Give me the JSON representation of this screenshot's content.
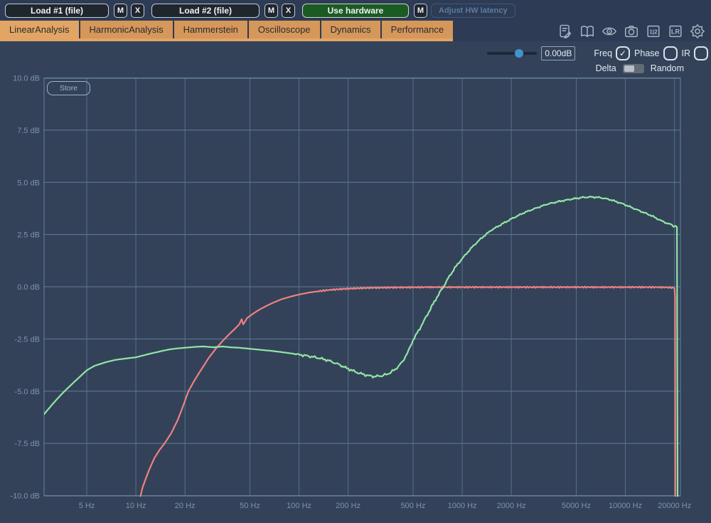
{
  "toolbar": {
    "load1_label": "Load #1 (file)",
    "m1_label": "M",
    "x1_label": "X",
    "load2_label": "Load #2 (file)",
    "m2_label": "M",
    "x2_label": "X",
    "use_hardware_label": "Use hardware",
    "m3_label": "M",
    "adjust_latency_label": "Adjust HW latency"
  },
  "tabs": [
    {
      "label": "LinearAnalysis",
      "active": true
    },
    {
      "label": "HarmonicAnalysis",
      "active": false
    },
    {
      "label": "Hammerstein",
      "active": false
    },
    {
      "label": "Oscilloscope",
      "active": false
    },
    {
      "label": "Dynamics",
      "active": false
    },
    {
      "label": "Performance",
      "active": false
    }
  ],
  "tab_icons": [
    {
      "name": "report-edit-icon"
    },
    {
      "name": "manual-book-icon"
    },
    {
      "name": "eye-icon"
    },
    {
      "name": "snapshot-camera-icon"
    },
    {
      "name": "channel-12-icon",
      "label": "1|2"
    },
    {
      "name": "channel-lr-icon",
      "label": "LR"
    },
    {
      "name": "settings-gear-icon"
    }
  ],
  "glyphs": {
    "check": "✓"
  },
  "controls": {
    "gain_value": "0.00dB",
    "slider_position": 0.67,
    "checkboxes": [
      {
        "id": "freq",
        "label": "Freq",
        "checked": true
      },
      {
        "id": "phase",
        "label": "Phase",
        "checked": false
      },
      {
        "id": "ir",
        "label": "IR",
        "checked": false
      }
    ],
    "delta_label": "Delta",
    "random_label": "Random",
    "delta_random_state": "left"
  },
  "store_button_label": "Store",
  "colors": {
    "topbar_bg": "#2d3b54",
    "chart_bg": "#334259",
    "tab_active": "#e2a565",
    "tab_inactive": "#d5975a",
    "use_hardware_green": "#1c5a24",
    "grid_h": "#7190ab",
    "grid_v": "#5b7c99",
    "axis_text": "#7c93aa",
    "series_red": "#ee8181",
    "series_green": "#92e5a5"
  },
  "chart_data": {
    "type": "line",
    "x_scale": "log",
    "x_unit": "Hz",
    "y_unit": "dB",
    "xlim": [
      2.74,
      21700
    ],
    "ylim": [
      -10,
      10
    ],
    "grid": true,
    "x_ticks": [
      {
        "f": 5,
        "label": "5 Hz"
      },
      {
        "f": 10,
        "label": "10 Hz"
      },
      {
        "f": 20,
        "label": "20 Hz"
      },
      {
        "f": 50,
        "label": "50 Hz"
      },
      {
        "f": 100,
        "label": "100 Hz"
      },
      {
        "f": 200,
        "label": "200 Hz"
      },
      {
        "f": 500,
        "label": "500 Hz"
      },
      {
        "f": 1000,
        "label": "1000 Hz"
      },
      {
        "f": 2000,
        "label": "2000 Hz"
      },
      {
        "f": 5000,
        "label": "5000 Hz"
      },
      {
        "f": 10000,
        "label": "10000 Hz"
      },
      {
        "f": 20000,
        "label": "20000 Hz"
      }
    ],
    "y_ticks": [
      {
        "v": 10,
        "label": "10.0 dB"
      },
      {
        "v": 7.5,
        "label": "7.5 dB"
      },
      {
        "v": 5,
        "label": "5.0 dB"
      },
      {
        "v": 2.5,
        "label": "2.5 dB"
      },
      {
        "v": 0,
        "label": "0.0 dB"
      },
      {
        "v": -2.5,
        "label": "-2.5 dB"
      },
      {
        "v": -5,
        "label": "-5.0 dB"
      },
      {
        "v": -7.5,
        "label": "-7.5 dB"
      },
      {
        "v": -10,
        "label": "-10.0 dB"
      }
    ],
    "series": [
      {
        "name": "red-curve-highpass",
        "color": "#ee8181",
        "points": [
          [
            10.4,
            -10.4
          ],
          [
            11,
            -9.6
          ],
          [
            12,
            -8.8
          ],
          [
            13,
            -8.2
          ],
          [
            14,
            -7.8
          ],
          [
            15,
            -7.5
          ],
          [
            16.5,
            -7.0
          ],
          [
            18,
            -6.4
          ],
          [
            19.5,
            -5.7
          ],
          [
            21,
            -5.0
          ],
          [
            23,
            -4.45
          ],
          [
            25,
            -4.0
          ],
          [
            28,
            -3.4
          ],
          [
            31,
            -2.95
          ],
          [
            34,
            -2.6
          ],
          [
            37,
            -2.3
          ],
          [
            40,
            -2.05
          ],
          [
            43,
            -1.8
          ],
          [
            44.5,
            -1.55
          ],
          [
            45.5,
            -1.8
          ],
          [
            48,
            -1.5
          ],
          [
            52,
            -1.3
          ],
          [
            57,
            -1.1
          ],
          [
            63,
            -0.92
          ],
          [
            70,
            -0.75
          ],
          [
            78,
            -0.6
          ],
          [
            88,
            -0.48
          ],
          [
            100,
            -0.37
          ],
          [
            115,
            -0.28
          ],
          [
            135,
            -0.2
          ],
          [
            160,
            -0.14
          ],
          [
            190,
            -0.1
          ],
          [
            230,
            -0.07
          ],
          [
            280,
            -0.05
          ],
          [
            350,
            -0.04
          ],
          [
            450,
            -0.03
          ],
          [
            600,
            -0.02
          ],
          [
            800,
            -0.02
          ],
          [
            1100,
            -0.02
          ],
          [
            1600,
            -0.02
          ],
          [
            2400,
            -0.02
          ],
          [
            3500,
            -0.02
          ],
          [
            5000,
            -0.02
          ],
          [
            7500,
            -0.02
          ],
          [
            11000,
            -0.02
          ],
          [
            15000,
            -0.02
          ],
          [
            18000,
            -0.03
          ],
          [
            19500,
            -0.04
          ],
          [
            20000,
            -0.08
          ],
          [
            20150,
            -0.5
          ],
          [
            20250,
            -10.6
          ]
        ]
      },
      {
        "name": "green-curve-response",
        "color": "#92e5a5",
        "points": [
          [
            2.74,
            -6.1
          ],
          [
            3.1,
            -5.6
          ],
          [
            3.6,
            -5.05
          ],
          [
            4.2,
            -4.55
          ],
          [
            5.0,
            -4.0
          ],
          [
            5.6,
            -3.78
          ],
          [
            6.5,
            -3.62
          ],
          [
            7.5,
            -3.5
          ],
          [
            9,
            -3.42
          ],
          [
            10,
            -3.38
          ],
          [
            12,
            -3.22
          ],
          [
            14,
            -3.1
          ],
          [
            16,
            -3.0
          ],
          [
            18,
            -2.95
          ],
          [
            20,
            -2.92
          ],
          [
            23,
            -2.88
          ],
          [
            26,
            -2.86
          ],
          [
            30,
            -2.9
          ],
          [
            34,
            -2.86
          ],
          [
            38,
            -2.9
          ],
          [
            43,
            -2.92
          ],
          [
            50,
            -2.97
          ],
          [
            58,
            -3.02
          ],
          [
            68,
            -3.07
          ],
          [
            80,
            -3.14
          ],
          [
            95,
            -3.22
          ],
          [
            110,
            -3.3
          ],
          [
            130,
            -3.4
          ],
          [
            150,
            -3.52
          ],
          [
            175,
            -3.72
          ],
          [
            200,
            -3.93
          ],
          [
            230,
            -4.12
          ],
          [
            260,
            -4.24
          ],
          [
            290,
            -4.3
          ],
          [
            320,
            -4.26
          ],
          [
            350,
            -4.18
          ],
          [
            390,
            -3.95
          ],
          [
            430,
            -3.6
          ],
          [
            470,
            -3.05
          ],
          [
            500,
            -2.55
          ],
          [
            550,
            -2.0
          ],
          [
            600,
            -1.45
          ],
          [
            650,
            -0.95
          ],
          [
            700,
            -0.5
          ],
          [
            760,
            -0.05
          ],
          [
            820,
            0.4
          ],
          [
            900,
            0.9
          ],
          [
            1000,
            1.35
          ],
          [
            1150,
            1.9
          ],
          [
            1300,
            2.3
          ],
          [
            1500,
            2.7
          ],
          [
            1750,
            3.0
          ],
          [
            2000,
            3.25
          ],
          [
            2400,
            3.55
          ],
          [
            2800,
            3.75
          ],
          [
            3300,
            3.95
          ],
          [
            4000,
            4.1
          ],
          [
            4700,
            4.2
          ],
          [
            5500,
            4.28
          ],
          [
            6200,
            4.3
          ],
          [
            7000,
            4.27
          ],
          [
            8000,
            4.18
          ],
          [
            9000,
            4.05
          ],
          [
            10000,
            3.92
          ],
          [
            11500,
            3.72
          ],
          [
            13000,
            3.55
          ],
          [
            14500,
            3.4
          ],
          [
            16000,
            3.22
          ],
          [
            17500,
            3.08
          ],
          [
            18500,
            3.0
          ],
          [
            19300,
            2.98
          ],
          [
            19700,
            2.88
          ],
          [
            20300,
            2.92
          ],
          [
            20700,
            2.86
          ],
          [
            20900,
            -10.6
          ]
        ]
      }
    ]
  }
}
